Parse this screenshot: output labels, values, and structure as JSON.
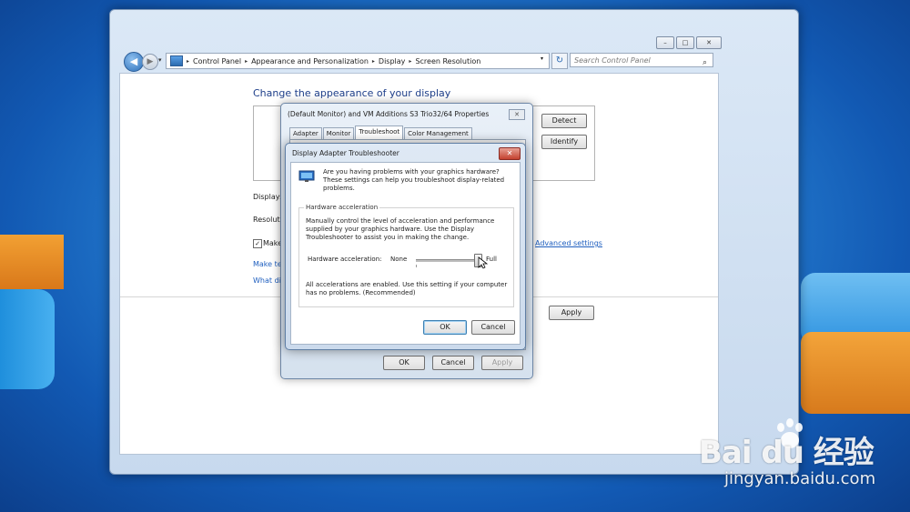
{
  "window": {
    "controls": [
      "–",
      "□",
      "✕"
    ]
  },
  "navbar": {
    "back_glyph": "◀",
    "forward_glyph": "▶",
    "history_glyph": "▾",
    "breadcrumbs": [
      "Control Panel",
      "Appearance and Personalization",
      "Display",
      "Screen Resolution"
    ],
    "search_placeholder": "Search Control Panel",
    "refresh_glyph": "↻"
  },
  "main": {
    "title": "Change the appearance of your display",
    "detect_label": "Detect",
    "identify_label": "Identify",
    "display_label": "Display:",
    "resolution_label": "Resolutio",
    "make_text_label": "Make",
    "checkbox_checked": true,
    "make_link": "Make te",
    "what_link": "What dis",
    "advanced_link": "Advanced settings",
    "apply_label": "Apply"
  },
  "properties_dialog": {
    "title": "(Default Monitor) and VM Additions S3 Trio32/64 Properties",
    "close_glyph": "✕",
    "tabs": [
      "Adapter",
      "Monitor",
      "Troubleshoot",
      "Color Management"
    ],
    "active_tab": "Troubleshoot",
    "ok_label": "OK",
    "cancel_label": "Cancel",
    "apply_label": "Apply"
  },
  "troubleshooter": {
    "title": "Display Adapter Troubleshooter",
    "close_glyph": "✕",
    "intro": "Are you having problems with your graphics hardware? These settings can help you troubleshoot display-related problems.",
    "group_label": "Hardware acceleration",
    "description": "Manually control the level of acceleration and performance supplied by your graphics hardware. Use the Display Troubleshooter to assist you in making the change.",
    "slider_label": "Hardware acceleration:",
    "slider_min_label": "None",
    "slider_max_label": "Full",
    "slider_value": 1.0,
    "status": "All accelerations are enabled. Use this setting if your computer has no problems. (Recommended)",
    "ok_label": "OK",
    "cancel_label": "Cancel"
  },
  "watermark": {
    "logo": "Bai du 经验",
    "url": "jingyan.baidu.com"
  },
  "colors": {
    "title_blue": "#1e3f8a",
    "link_blue": "#1f5fbf"
  }
}
